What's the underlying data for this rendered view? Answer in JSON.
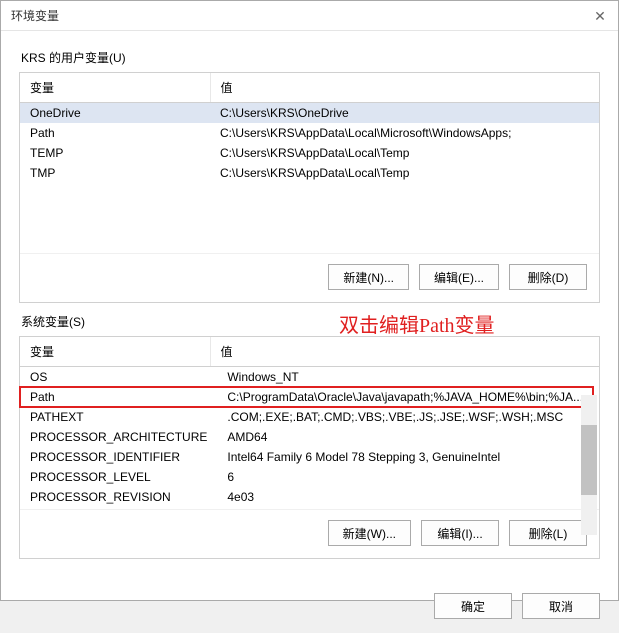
{
  "window": {
    "title": "环境变量"
  },
  "user_section": {
    "label": "KRS 的用户变量(U)",
    "columns": {
      "name": "变量",
      "value": "值"
    },
    "rows": [
      {
        "name": "OneDrive",
        "value": "C:\\Users\\KRS\\OneDrive"
      },
      {
        "name": "Path",
        "value": "C:\\Users\\KRS\\AppData\\Local\\Microsoft\\WindowsApps;"
      },
      {
        "name": "TEMP",
        "value": "C:\\Users\\KRS\\AppData\\Local\\Temp"
      },
      {
        "name": "TMP",
        "value": "C:\\Users\\KRS\\AppData\\Local\\Temp"
      }
    ],
    "buttons": {
      "new": "新建(N)...",
      "edit": "编辑(E)...",
      "delete": "删除(D)"
    }
  },
  "system_section": {
    "label": "系统变量(S)",
    "columns": {
      "name": "变量",
      "value": "值"
    },
    "rows": [
      {
        "name": "OS",
        "value": "Windows_NT"
      },
      {
        "name": "Path",
        "value": "C:\\ProgramData\\Oracle\\Java\\javapath;%JAVA_HOME%\\bin;%JA..."
      },
      {
        "name": "PATHEXT",
        "value": ".COM;.EXE;.BAT;.CMD;.VBS;.VBE;.JS;.JSE;.WSF;.WSH;.MSC"
      },
      {
        "name": "PROCESSOR_ARCHITECTURE",
        "value": "AMD64"
      },
      {
        "name": "PROCESSOR_IDENTIFIER",
        "value": "Intel64 Family 6 Model 78 Stepping 3, GenuineIntel"
      },
      {
        "name": "PROCESSOR_LEVEL",
        "value": "6"
      },
      {
        "name": "PROCESSOR_REVISION",
        "value": "4e03"
      }
    ],
    "buttons": {
      "new": "新建(W)...",
      "edit": "编辑(I)...",
      "delete": "删除(L)"
    }
  },
  "dialog_buttons": {
    "ok": "确定",
    "cancel": "取消"
  },
  "annotation": "双击编辑Path变量"
}
